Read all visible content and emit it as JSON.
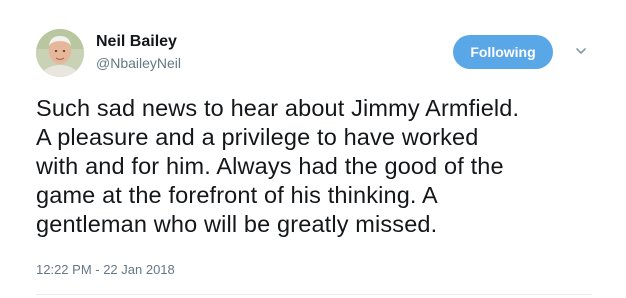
{
  "user": {
    "name": "Neil Bailey",
    "handle": "@NbaileyNeil",
    "avatar_icon": "profile-photo"
  },
  "follow_button": {
    "label": "Following",
    "color": "#5aa7e8"
  },
  "menu_icon": "chevron-down-icon",
  "tweet": {
    "lines": [
      "Such sad news to hear about Jimmy Armfield.",
      "A pleasure and a privilege to have worked",
      "with and for him. Always had the good of the",
      "game at the forefront of his thinking. A",
      "gentleman who will be greatly missed."
    ],
    "timestamp": "12:22 PM - 22 Jan 2018"
  },
  "colors": {
    "text": "#14171a",
    "secondary": "#657786",
    "accent": "#5aa7e8"
  }
}
